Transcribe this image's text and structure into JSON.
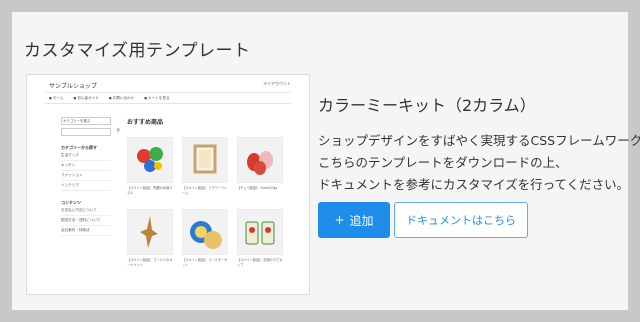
{
  "section": {
    "title": "カスタマイズ用テンプレート"
  },
  "preview": {
    "shop_name": "サンプルショップ",
    "account": "マイアカウント",
    "nav": [
      "ホーム",
      "初心者ガイド",
      "お問い合わせ",
      "カートを見る"
    ],
    "select_placeholder": "カテゴリーを選ぶ",
    "sidebar_sections": [
      {
        "title": "カテゴリーから探す",
        "links": [
          "生活グッズ",
          "キッチン",
          "ファッション",
          "インテリア"
        ]
      },
      {
        "title": "コンテンツ",
        "links": [
          "お支払い方法について",
          "配送方法・送料について",
          "会社案内・特商法"
        ]
      }
    ],
    "heading": "おすすめ商品",
    "products": [
      "【スペイン製品】 陶器の木製パネル",
      "【スペイン製品】 フラワーフレーム",
      "【チェコ製品】 Forest-Egg",
      "【スペイン製品】 ゴールドのオーナメント",
      "【スペイン製品】 コースターセット",
      "【スペイン製品】 花柄のマグカップ"
    ]
  },
  "kit": {
    "title": "カラーミーキット（2カラム）",
    "description": [
      "ショップデザインをすばやく実現するCSSフレームワーク。",
      "こちらのテンプレートをダウンロードの上、",
      "ドキュメントを参考にカスタマイズを行ってください。"
    ],
    "add_button": "追加",
    "add_icon": "+",
    "doc_button": "ドキュメントはこちら"
  }
}
